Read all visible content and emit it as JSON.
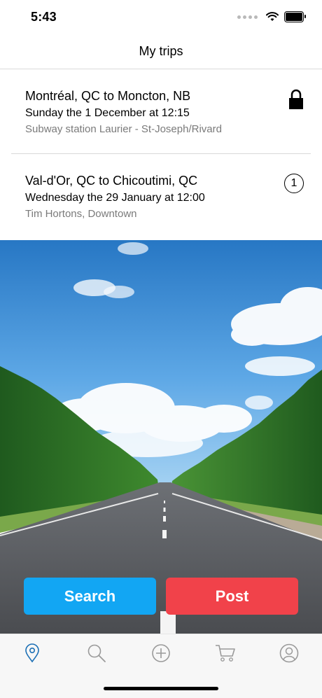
{
  "status_bar": {
    "time": "5:43"
  },
  "nav": {
    "title": "My trips"
  },
  "trips": [
    {
      "route": "Montréal, QC to Moncton, NB",
      "when": "Sunday the 1 December at 12:15",
      "where": "Subway station Laurier - St-Joseph/Rivard",
      "icon": "lock-icon"
    },
    {
      "route": "Val-d'Or, QC to Chicoutimi, QC",
      "when": "Wednesday the 29 January at 12:00",
      "where": "Tim Hortons, Downtown",
      "badge": "1"
    }
  ],
  "actions": {
    "search_label": "Search",
    "post_label": "Post"
  },
  "tabs": [
    {
      "icon": "map-pin-icon",
      "active": true
    },
    {
      "icon": "search-icon",
      "active": false
    },
    {
      "icon": "add-circle-icon",
      "active": false
    },
    {
      "icon": "cart-icon",
      "active": false
    },
    {
      "icon": "profile-icon",
      "active": false
    }
  ],
  "colors": {
    "search_button": "#12a6f3",
    "post_button": "#f1424a",
    "active_tab": "#1b6fb5",
    "inactive_tab": "#9a9a9a"
  }
}
